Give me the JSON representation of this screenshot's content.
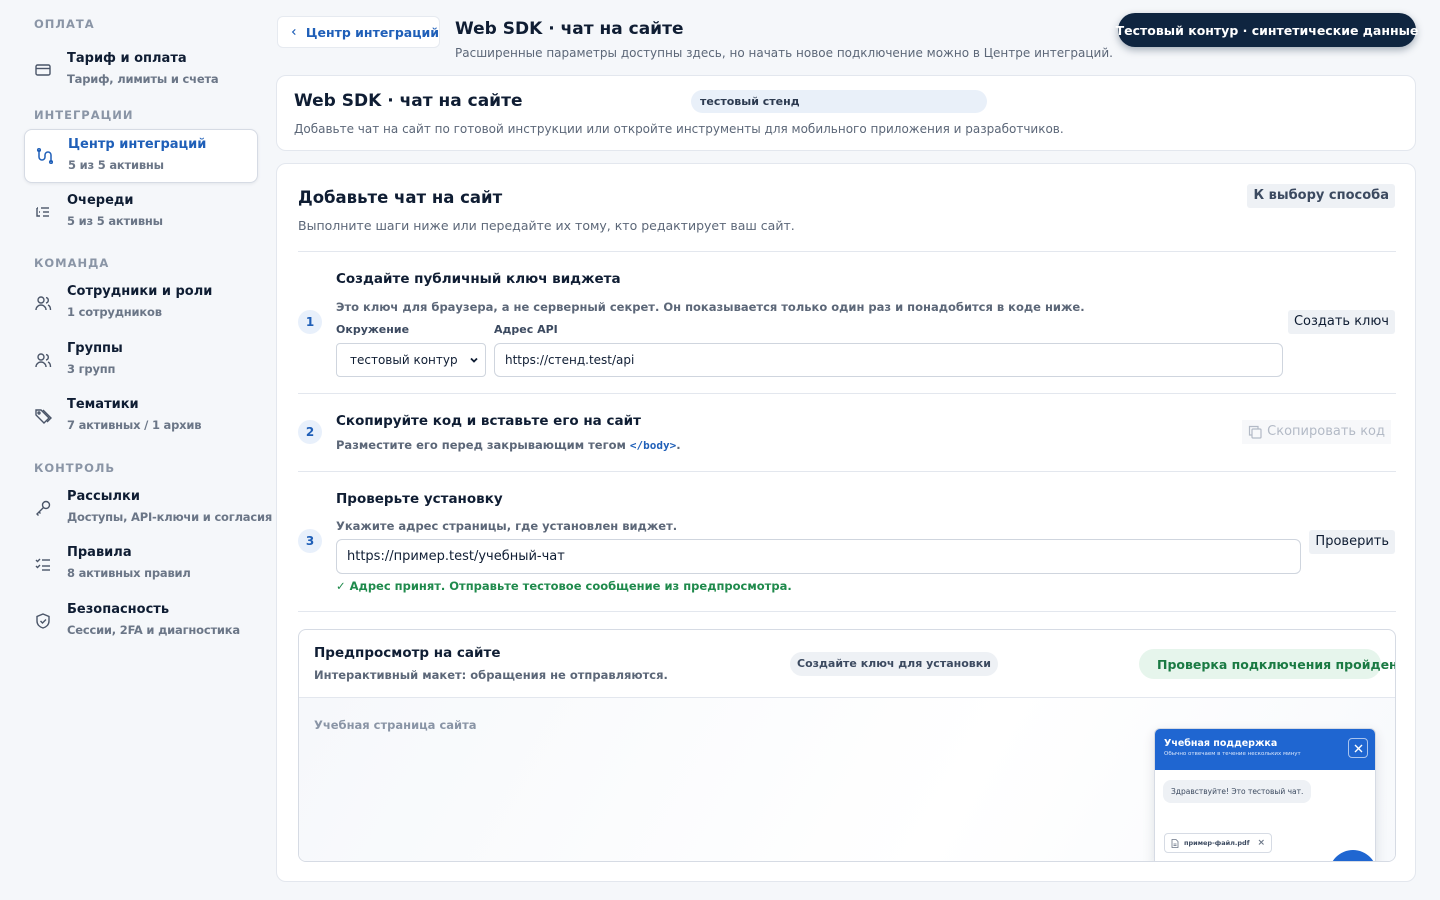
{
  "sidebar": {
    "sections": [
      {
        "title": "ОПЛАТА"
      },
      {
        "title": "ИНТЕГРАЦИИ"
      },
      {
        "title": "КОМАНДА"
      },
      {
        "title": "КОНТРОЛЬ"
      }
    ],
    "items": [
      {
        "label": "Тариф и оплата",
        "sub": "Тариф, лимиты и счета",
        "icon": "card-icon"
      },
      {
        "label": "Центр интеграций",
        "sub": "5 из 5 активны",
        "icon": "integration-icon",
        "active": true
      },
      {
        "label": "Очереди",
        "sub": "5 из 5 активны",
        "icon": "queue-icon"
      },
      {
        "label": "Сотрудники и роли",
        "sub": "1 сотрудников",
        "icon": "user-icon"
      },
      {
        "label": "Группы",
        "sub": "3 групп",
        "icon": "group-icon"
      },
      {
        "label": "Тематики",
        "sub": "7 активных / 1 архив",
        "icon": "tag-icon"
      },
      {
        "label": "Рассылки",
        "sub": "Доступы, API-ключи и согласия",
        "icon": "key-icon"
      },
      {
        "label": "Правила",
        "sub": "8 активных правил",
        "icon": "rules-icon"
      },
      {
        "label": "Безопасность",
        "sub": "Сессии, 2FA и диагностика",
        "icon": "shield-icon"
      }
    ]
  },
  "header": {
    "back_label": "Центр интеграций",
    "title": "Web SDK · чат на сайте",
    "subtitle": "Расширенные параметры доступны здесь, но начать новое подключение можно в Центре интеграций.",
    "env_pill": "Тестовый контур · синтетические данные"
  },
  "info": {
    "title": "Web SDK · чат на сайте",
    "badge": "тестовый стенд",
    "subtitle": "Добавьте чат на сайт по готовой инструкции или откройте инструменты для мобильного приложения и разработчиков."
  },
  "main": {
    "title": "Добавьте чат на сайт",
    "subtitle": "Выполните шаги ниже или передайте их тому, кто редактирует ваш сайт.",
    "choose_label": "К выбору способа",
    "step1": {
      "num": "1",
      "title": "Создайте публичный ключ виджета",
      "desc": "Это ключ для браузера, а не серверный секрет. Он показывается только один раз и понадобится в коде ниже.",
      "env_label": "Окружение",
      "env_value": "тестовый контур",
      "api_label": "Адрес API",
      "api_value": "https://стенд.test/api",
      "button": "Создать ключ"
    },
    "step2": {
      "num": "2",
      "title": "Скопируйте код и вставьте его на сайт",
      "desc_before": "Разместите его перед закрывающим тегом ",
      "desc_tag": "</body>",
      "desc_after": ".",
      "button": "Скопировать код"
    },
    "step3": {
      "num": "3",
      "title": "Проверьте установку",
      "desc": "Укажите адрес страницы, где установлен виджет.",
      "url_value": "https://пример.test/учебный-чат",
      "button": "Проверить",
      "ok_message": "✓ Адрес принят. Отправьте тестовое сообщение из предпросмотра."
    },
    "preview": {
      "title": "Предпросмотр на сайте",
      "subtitle": "Интерактивный макет: обращения не отправляются.",
      "key_badge": "Создайте ключ для установки",
      "status": "Проверка подключения пройдена",
      "page_label": "Учебная страница сайта",
      "chat": {
        "title": "Учебная поддержка",
        "subtitle": "Обычно отвечаем в течение нескольких минут",
        "message": "Здравствуйте! Это тестовый чат.",
        "file": "пример-файл.pdf"
      }
    }
  },
  "colors": {
    "accent": "#1f5fb8",
    "chat_brand": "#1f66d1",
    "success": "#1a7a43",
    "env_pill_bg": "#0f2540"
  }
}
